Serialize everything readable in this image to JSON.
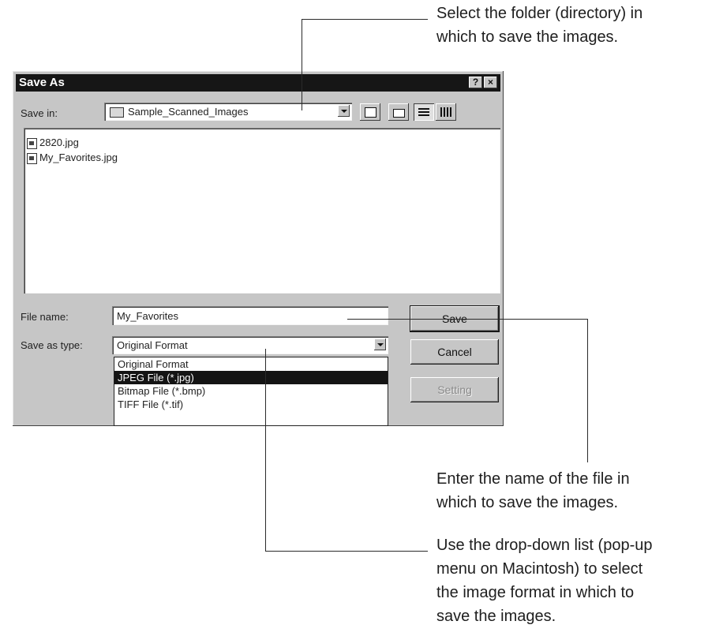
{
  "callouts": {
    "folder": "Select the folder (directory) in\nwhich to save the images.",
    "filename": "Enter the name of the file in\nwhich to save the images.",
    "format": "Use the drop-down list (pop-up\nmenu on Macintosh) to select\nthe image format in which to\nsave the images."
  },
  "dialog": {
    "title": "Save As",
    "help_glyph": "?",
    "close_glyph": "×",
    "save_in_label": "Save in:",
    "save_in_value": "Sample_Scanned_Images",
    "files": [
      "2820.jpg",
      "My_Favorites.jpg"
    ],
    "file_name_label": "File name:",
    "file_name_value": "My_Favorites",
    "save_as_type_label": "Save as type:",
    "save_as_type_value": "Original Format",
    "type_options": [
      "Original Format",
      "JPEG File (*.jpg)",
      "Bitmap File (*.bmp)",
      "TIFF File (*.tif)"
    ],
    "selected_type_index": 1,
    "buttons": {
      "save": "Save",
      "cancel": "Cancel",
      "setting": "Setting"
    }
  }
}
